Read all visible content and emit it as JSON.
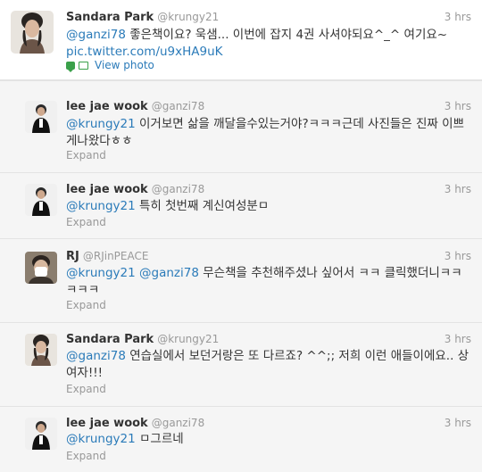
{
  "tweets": [
    {
      "name": "Sandara Park",
      "handle": "@krungy21",
      "time": "3 hrs",
      "mention": "@ganzi78",
      "line1": " 좋은책이요? 욱샘... 이번에 잡지 4권 사셔야되요^_^ 여기요~",
      "link": "pic.twitter.com/u9xHA9uK",
      "view_photo": "View photo"
    },
    {
      "name": "lee jae wook",
      "handle": "@ganzi78",
      "time": "3 hrs",
      "mention": "@krungy21",
      "text": " 이거보면 삶을 깨달을수있는거야?ㅋㅋㅋ근데 사진들은 진짜 이쁘게나왔다ㅎㅎ",
      "expand": "Expand"
    },
    {
      "name": "lee jae wook",
      "handle": "@ganzi78",
      "time": "3 hrs",
      "mention": "@krungy21",
      "text": " 특히 첫번째 계신여성분ㅁ",
      "expand": "Expand"
    },
    {
      "name": "RJ",
      "handle": "@RJinPEACE",
      "time": "3 hrs",
      "mention": "@krungy21",
      "mention2": "@ganzi78",
      "text": " 무슨책을 추천해주셨나 싶어서 ㅋㅋ 클릭했더니ㅋㅋㅋㅋㅋ",
      "expand": "Expand"
    },
    {
      "name": "Sandara Park",
      "handle": "@krungy21",
      "time": "3 hrs",
      "mention": "@ganzi78",
      "text": " 연습실에서 보던거랑은 또 다르죠? ^^;; 저희 이런 애들이에요.. 상여자!!!",
      "expand": "Expand"
    },
    {
      "name": "lee jae wook",
      "handle": "@ganzi78",
      "time": "3 hrs",
      "mention": "@krungy21",
      "text": " ㅁ그르네",
      "expand": "Expand"
    }
  ]
}
